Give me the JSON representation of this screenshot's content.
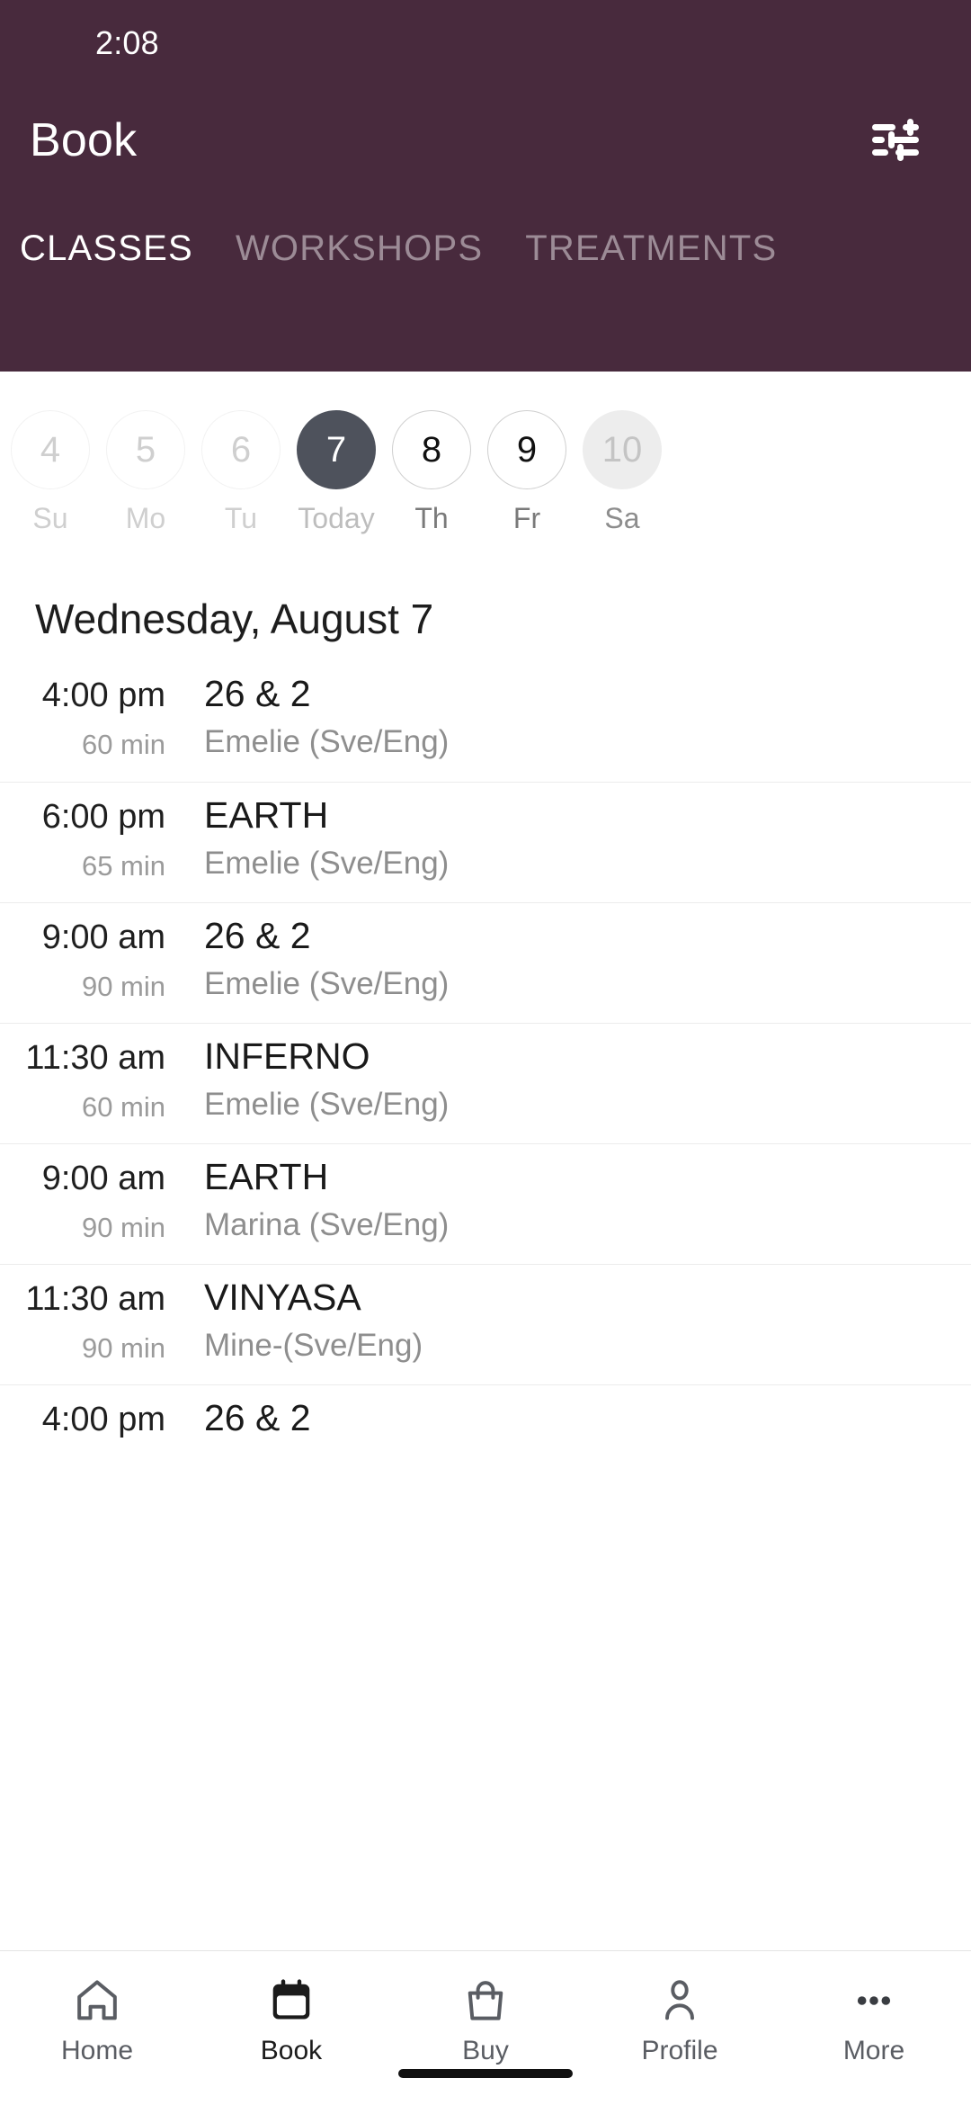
{
  "status": {
    "time": "2:08"
  },
  "header": {
    "title": "Book",
    "filter_icon": "tune-icon",
    "bg_color": "#482A3D",
    "tabs": [
      {
        "label": "CLASSES",
        "active": true
      },
      {
        "label": "WORKSHOPS",
        "active": false
      },
      {
        "label": "TREATMENTS",
        "active": false
      }
    ]
  },
  "date_strip": {
    "days": [
      {
        "number": "4",
        "weekday": "Su",
        "state": "past"
      },
      {
        "number": "5",
        "weekday": "Mo",
        "state": "past"
      },
      {
        "number": "6",
        "weekday": "Tu",
        "state": "past"
      },
      {
        "number": "7",
        "weekday": "Today",
        "state": "today"
      },
      {
        "number": "8",
        "weekday": "Th",
        "state": "future"
      },
      {
        "number": "9",
        "weekday": "Fr",
        "state": "future"
      },
      {
        "number": "10",
        "weekday": "Sa",
        "state": "loading"
      }
    ]
  },
  "day_heading": "Wednesday, August 7",
  "classes": [
    {
      "time": "4:00 pm",
      "duration": "60 min",
      "name": "26 & 2",
      "teacher": "Emelie (Sve/Eng)"
    },
    {
      "time": "6:00 pm",
      "duration": "65 min",
      "name": "EARTH",
      "teacher": "Emelie (Sve/Eng)"
    },
    {
      "time": "9:00 am",
      "duration": "90 min",
      "name": "26 & 2",
      "teacher": "Emelie (Sve/Eng)"
    },
    {
      "time": "11:30 am",
      "duration": "60 min",
      "name": "INFERNO",
      "teacher": "Emelie (Sve/Eng)"
    },
    {
      "time": "9:00 am",
      "duration": "90 min",
      "name": "EARTH",
      "teacher": "Marina (Sve/Eng)"
    },
    {
      "time": "11:30 am",
      "duration": "90 min",
      "name": "VINYASA",
      "teacher": "Mine-(Sve/Eng)"
    },
    {
      "time": "4:00 pm",
      "duration": "",
      "name": "26 & 2",
      "teacher": ""
    }
  ],
  "bottom_nav": {
    "items": [
      {
        "label": "Home",
        "icon": "home-icon",
        "active": false
      },
      {
        "label": "Book",
        "icon": "calendar-icon",
        "active": true
      },
      {
        "label": "Buy",
        "icon": "bag-icon",
        "active": false
      },
      {
        "label": "Profile",
        "icon": "person-icon",
        "active": false
      },
      {
        "label": "More",
        "icon": "dots-icon",
        "active": false
      }
    ]
  }
}
